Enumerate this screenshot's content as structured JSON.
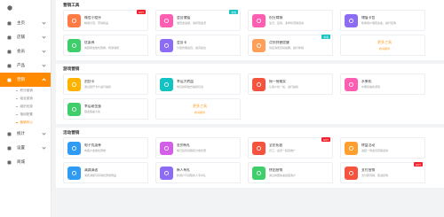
{
  "sidebar": {
    "items": [
      {
        "label": "主页",
        "icon": "home-icon",
        "color": "#666666",
        "expanded": false
      },
      {
        "label": "店铺",
        "icon": "shop-icon",
        "color": "#666666",
        "expanded": false
      },
      {
        "label": "会员",
        "icon": "user-icon",
        "color": "#666666",
        "expanded": false
      },
      {
        "label": "产品",
        "icon": "box-icon",
        "color": "#666666",
        "expanded": false
      },
      {
        "label": "营销",
        "icon": "tag-icon",
        "color": "#ffffff",
        "expanded": true
      }
    ],
    "sub_items": [
      {
        "label": "积分营销",
        "current": false
      },
      {
        "label": "组合促销",
        "current": false
      },
      {
        "label": "组织优惠",
        "current": false
      },
      {
        "label": "指标配置",
        "current": false
      },
      {
        "label": "营销中心",
        "current": true
      }
    ],
    "bottom_items": [
      {
        "label": "统计",
        "icon": "chart-icon"
      },
      {
        "label": "设置",
        "icon": "gear-icon"
      },
      {
        "label": "商城",
        "icon": "store-icon"
      }
    ]
  },
  "sections": [
    {
      "title": "营销工具",
      "cards": [
        {
          "name": "微信小程序",
          "desc": "精准引流，带动新品",
          "color": "#ff7a45",
          "icon": "miniapp-icon",
          "badge": "HOT",
          "badge_color": "#f5222d"
        },
        {
          "name": "会员储值",
          "desc": "储值送金额，收获现金流",
          "color": "#ff5db1",
          "icon": "wallet-icon",
          "badge": "新版",
          "badge_color": "#13c2c2"
        },
        {
          "name": "积分商城",
          "desc": "生日、签到、多样化营销活动",
          "color": "#ff5db1",
          "icon": "gift-icon",
          "badge": "",
          "badge_color": ""
        },
        {
          "name": "储值卡包",
          "desc": "吸收用户储值资金，提升复购",
          "color": "#8c6cf5",
          "icon": "card-icon",
          "badge": "",
          "badge_color": ""
        },
        {
          "name": "优惠券",
          "desc": "向顾客发放优惠券，刺激消费",
          "color": "#3ecf6b",
          "icon": "coupon-icon",
          "badge": "",
          "badge_color": ""
        },
        {
          "name": "会员卡",
          "desc": "分层管理会员，提高粘性",
          "color": "#8c6cf5",
          "icon": "vip-icon",
          "badge": "",
          "badge_color": ""
        },
        {
          "name": "点到到便提醒",
          "desc": "到店消费自动提醒，提升体验",
          "color": "#ff9f5a",
          "icon": "bell-icon",
          "badge": "新版",
          "badge_color": "#13c2c2"
        },
        {
          "name": "更多工具",
          "desc": "敬请期待",
          "color": "",
          "icon": "",
          "badge": "",
          "badge_color": "",
          "more": true
        }
      ]
    },
    {
      "title": "游戏营销",
      "cards": [
        {
          "name": "刮刮卡",
          "desc": "通过刮开卡片进行抽奖",
          "color": "#ffb300",
          "icon": "scratch-icon",
          "badge": "",
          "badge_color": ""
        },
        {
          "name": "幸运大转盘",
          "desc": "常见的转盘式抽奖玩法",
          "color": "#13c2c2",
          "icon": "wheel-icon",
          "badge": "",
          "badge_color": ""
        },
        {
          "name": "摇一摇抽奖",
          "desc": "让客户摇一摇，进行抽奖",
          "color": "#f5533d",
          "icon": "shake-icon",
          "badge": "",
          "badge_color": ""
        },
        {
          "name": "水果机",
          "desc": "水果机抽奖游戏",
          "color": "#ff5db1",
          "icon": "fruit-icon",
          "badge": "",
          "badge_color": ""
        },
        {
          "name": "幸运砸金蛋",
          "desc": "砸金蛋赢大奖",
          "color": "#3ecf6b",
          "icon": "egg-icon",
          "badge": "",
          "badge_color": ""
        },
        {
          "name": "更多工具",
          "desc": "敬请期待",
          "color": "",
          "icon": "",
          "badge": "",
          "badge_color": "",
          "more": true
        }
      ]
    },
    {
      "title": "活动营销",
      "cards": [
        {
          "name": "电子优惠券",
          "desc": "向客户发放优惠券",
          "color": "#2f9bf5",
          "icon": "ecoupon-icon",
          "badge": "",
          "badge_color": ""
        },
        {
          "name": "签到有礼",
          "desc": "每日签到领取积分或优惠",
          "color": "#d35ee8",
          "icon": "calendar-icon",
          "badge": "",
          "badge_color": ""
        },
        {
          "name": "全民拓客",
          "desc": "员工、会员一起来推广",
          "color": "#f5533d",
          "icon": "share-icon",
          "badge": "HOT",
          "badge_color": "#f5222d"
        },
        {
          "name": "转盘活动",
          "desc": "发起一场会员营销活动",
          "color": "#ff9f2e",
          "icon": "activity-icon",
          "badge": "",
          "badge_color": ""
        },
        {
          "name": "满减满送",
          "desc": "消费满额可获得优惠或赠品",
          "color": "#2f9bf5",
          "icon": "discount-icon",
          "badge": "",
          "badge_color": ""
        },
        {
          "name": "新人有礼",
          "desc": "新用户可领取新人专享礼",
          "color": "#8c6cf5",
          "icon": "newuser-icon",
          "badge": "",
          "badge_color": ""
        },
        {
          "name": "拼团营销",
          "desc": "通过拼团快速裂变客户",
          "color": "#3ecf6b",
          "icon": "group-icon",
          "badge": "",
          "badge_color": ""
        },
        {
          "name": "支付营销",
          "desc": "支付即营销，促进复购",
          "color": "#f5533d",
          "icon": "pay-icon",
          "badge": "HOT",
          "badge_color": "#f5222d"
        }
      ]
    }
  ]
}
